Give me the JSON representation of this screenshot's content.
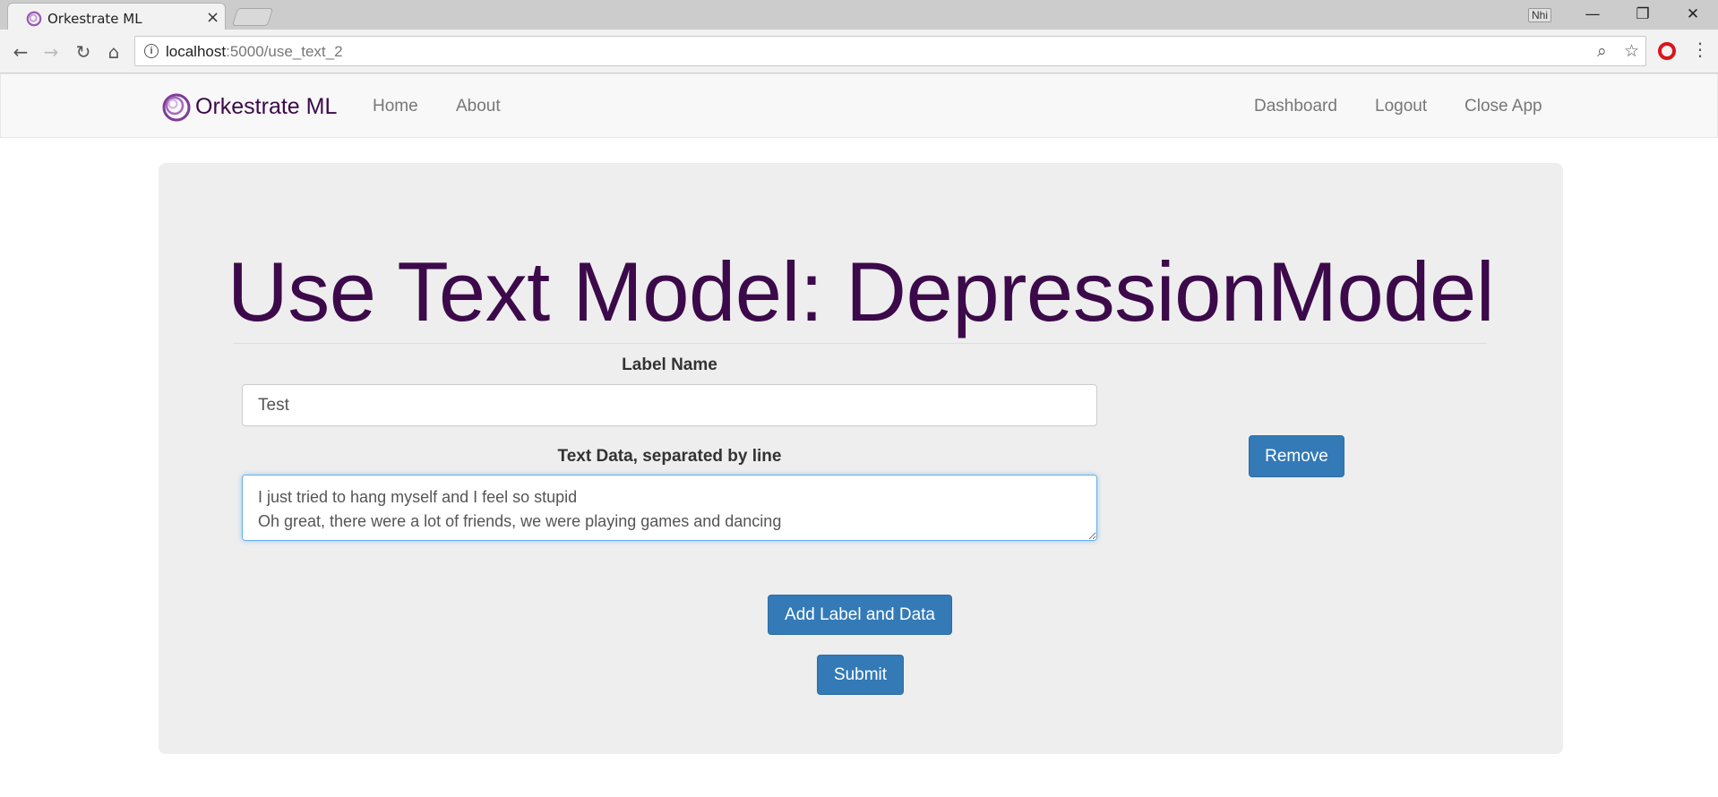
{
  "browser": {
    "tab_title": "Orkestrate ML",
    "tab_close": "×",
    "user_badge": "Nhi",
    "url_host": "localhost",
    "url_path": ":5000/use_text_2"
  },
  "navbar": {
    "brand": "Orkestrate ML",
    "left_links": [
      "Home",
      "About"
    ],
    "right_links": [
      "Dashboard",
      "Logout",
      "Close App"
    ]
  },
  "page": {
    "title": "Use Text Model: DepressionModel",
    "label_name_label": "Label Name",
    "label_name_value": "Test",
    "text_data_label": "Text Data, separated by line",
    "text_data_value": "I just tried to hang myself and I feel so stupid\nOh great, there were a lot of friends, we were playing games and dancing",
    "remove_button": "Remove",
    "add_button": "Add Label and Data",
    "submit_button": "Submit"
  },
  "colors": {
    "brand_purple": "#3c0a4a",
    "button_blue": "#337ab7",
    "jumbotron_bg": "#eeeeee"
  }
}
